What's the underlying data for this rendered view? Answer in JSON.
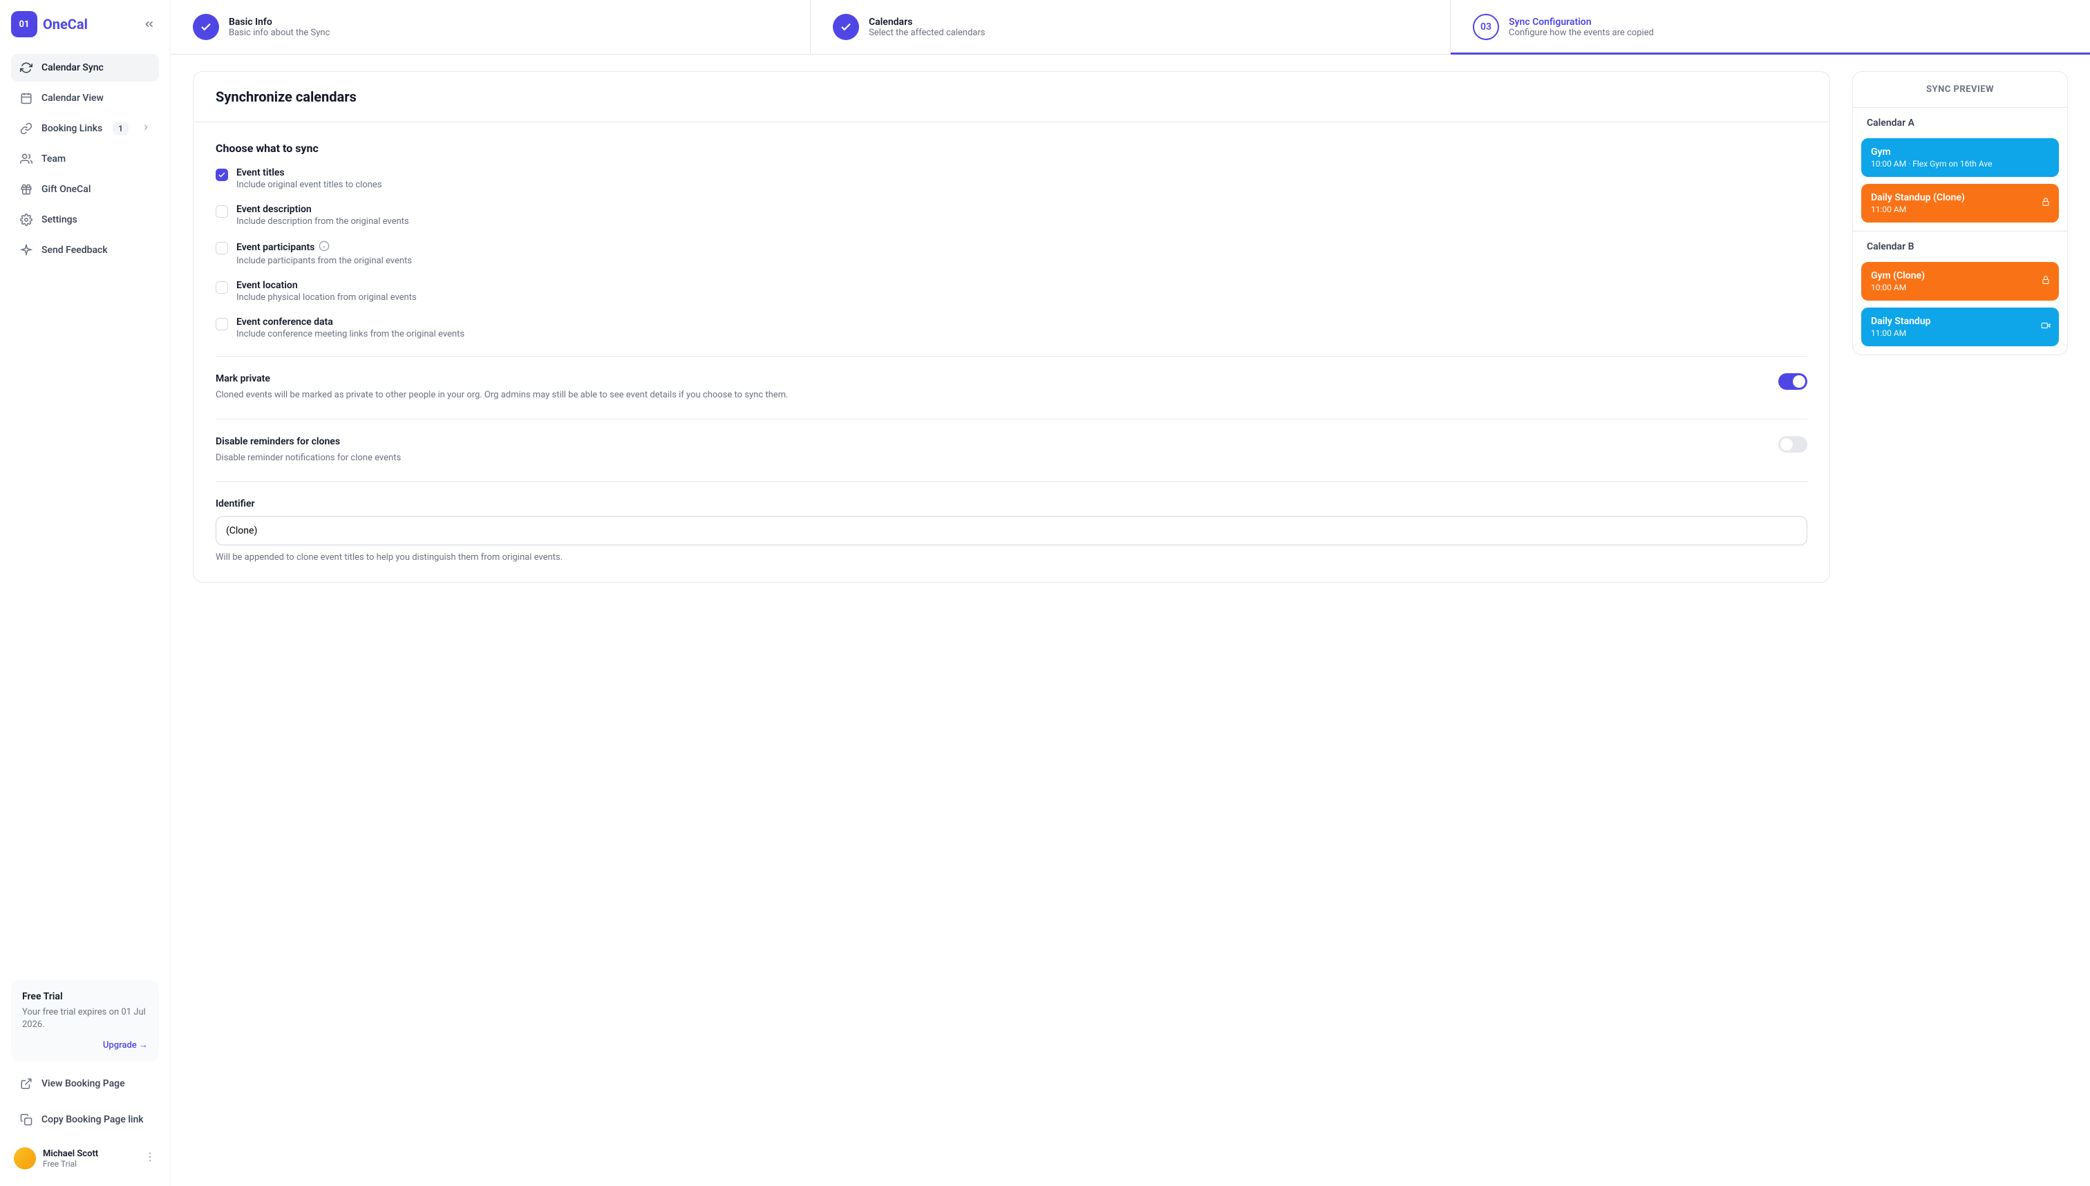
{
  "brand": {
    "icon_text": "01",
    "name": "OneCal"
  },
  "sidebar": {
    "items": [
      {
        "label": "Calendar Sync"
      },
      {
        "label": "Calendar View"
      },
      {
        "label": "Booking Links",
        "badge": "1"
      },
      {
        "label": "Team"
      },
      {
        "label": "Gift OneCal"
      },
      {
        "label": "Settings"
      },
      {
        "label": "Send Feedback"
      }
    ],
    "bottom": [
      {
        "label": "View Booking Page"
      },
      {
        "label": "Copy Booking Page link"
      }
    ],
    "trial": {
      "title": "Free Trial",
      "text": "Your free trial expires on 01 Jul 2026.",
      "upgrade": "Upgrade →"
    },
    "user": {
      "name": "Michael Scott",
      "plan": "Free Trial"
    }
  },
  "stepper": {
    "steps": [
      {
        "title": "Basic Info",
        "sub": "Basic info about the Sync"
      },
      {
        "title": "Calendars",
        "sub": "Select the affected calendars"
      },
      {
        "num": "03",
        "title": "Sync Configuration",
        "sub": "Configure how the events are copied"
      }
    ]
  },
  "sync": {
    "panel_title": "Synchronize calendars",
    "choose_title": "Choose what to sync",
    "options": [
      {
        "label": "Event titles",
        "sub": "Include original event titles to clones"
      },
      {
        "label": "Event description",
        "sub": "Include description from the original events"
      },
      {
        "label": "Event participants",
        "sub": "Include participants from the original events"
      },
      {
        "label": "Event location",
        "sub": "Include physical location from original events"
      },
      {
        "label": "Event conference data",
        "sub": "Include conference meeting links from the original events"
      }
    ],
    "mark_private": {
      "title": "Mark private",
      "sub": "Cloned events will be marked as private to other people in your org. Org admins may still be able to see event details if you choose to sync them."
    },
    "disable_reminders": {
      "title": "Disable reminders for clones",
      "sub": "Disable reminder notifications for clone events"
    },
    "identifier": {
      "label": "Identifier",
      "value": "(Clone)",
      "help": "Will be appended to clone event titles to help you distinguish them from original events."
    }
  },
  "preview": {
    "header": "SYNC PREVIEW",
    "calendars": [
      {
        "name": "Calendar A",
        "events": [
          {
            "title": "Gym",
            "time": "10:00 AM · Flex Gym on 16th Ave",
            "color": "blue"
          },
          {
            "title": "Daily Standup (Clone)",
            "time": "11:00 AM",
            "color": "orange",
            "icon": "lock"
          }
        ]
      },
      {
        "name": "Calendar B",
        "events": [
          {
            "title": "Gym (Clone)",
            "time": "10:00 AM",
            "color": "orange",
            "icon": "lock"
          },
          {
            "title": "Daily Standup",
            "time": "11:00 AM",
            "color": "blue",
            "icon": "video"
          }
        ]
      }
    ]
  }
}
